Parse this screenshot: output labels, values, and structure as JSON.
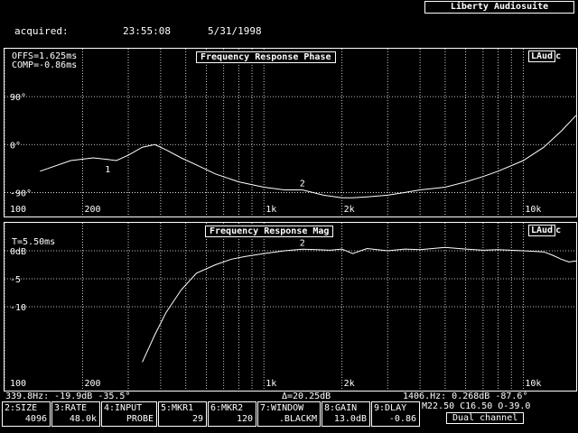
{
  "app": {
    "title": "Liberty Audiosuite"
  },
  "acquired": {
    "label": "acquired:",
    "time": "23:55:08",
    "date": "5/31/1998"
  },
  "phase_panel": {
    "title": "Frequency Response Phase",
    "logo_box": "LAud",
    "logo_suffix": "c",
    "offs": "OFFS=1.625ms",
    "comp": "COMP=-0.86ms",
    "marker1": "1",
    "marker2": "2"
  },
  "mag_panel": {
    "title": "Frequency Response Mag",
    "logo_box": "LAud",
    "logo_suffix": "c",
    "t": "T=5.50ms",
    "marker2": "2"
  },
  "status": {
    "left": "339.8Hz: -19.9dB  -35.5°",
    "mid": "Δ=20.25dB",
    "right": "1406.Hz: 0.268dB -87.6°"
  },
  "fkeys": [
    {
      "top": "2:SIZE",
      "bottom": "4096"
    },
    {
      "top": "3:RATE",
      "bottom": "48.0k"
    },
    {
      "top": "4:INPUT",
      "bottom": "PROBE"
    },
    {
      "top": "5:MKR1",
      "bottom": "29"
    },
    {
      "top": "6:MKR2",
      "bottom": "120"
    },
    {
      "top": "7:WINDOW",
      "bottom": ".BLACKM"
    },
    {
      "top": "8:GAIN",
      "bottom": "13.0dB"
    },
    {
      "top": "9:DLAY",
      "bottom": "-0.86"
    }
  ],
  "right_info": {
    "line1": "M22.50 C16.50 O-39.0",
    "dual": "Dual channel"
  },
  "chart_data": [
    {
      "type": "line",
      "title": "Frequency Response Phase",
      "xlabel": "",
      "ylabel": "",
      "x_scale": "log",
      "xlim": [
        100,
        16000
      ],
      "ylim": [
        -135,
        180
      ],
      "x_ticks": [
        {
          "v": 100,
          "label": "100"
        },
        {
          "v": 200,
          "label": "200"
        },
        {
          "v": 1000,
          "label": "1k"
        },
        {
          "v": 2000,
          "label": "2k"
        },
        {
          "v": 10000,
          "label": "10k"
        }
      ],
      "y_ticks": [
        {
          "v": 90,
          "label": "90°"
        },
        {
          "v": 0,
          "label": "0°"
        },
        {
          "v": -90,
          "label": "-90°"
        }
      ],
      "grid": true,
      "series": [
        {
          "x": [
            137,
            180,
            220,
            250,
            270,
            300,
            340,
            380,
            420,
            480,
            560,
            650,
            800,
            1000,
            1200,
            1406,
            1700,
            2000,
            2200,
            2500,
            3000,
            3500,
            4000,
            5000,
            6000,
            7000,
            8000,
            10000,
            12000,
            14000,
            16000
          ],
          "y": [
            -50,
            -30,
            -25,
            -28,
            -30,
            -20,
            -5,
            0,
            -10,
            -25,
            -40,
            -55,
            -70,
            -80,
            -85,
            -85,
            -95,
            -100,
            -100,
            -98,
            -95,
            -90,
            -85,
            -80,
            -70,
            -60,
            -50,
            -30,
            -5,
            25,
            55
          ]
        }
      ]
    },
    {
      "type": "line",
      "title": "Frequency Response Mag",
      "xlabel": "",
      "ylabel": "",
      "x_scale": "log",
      "xlim": [
        100,
        16000
      ],
      "ylim": [
        -25,
        5
      ],
      "x_ticks": [
        {
          "v": 100,
          "label": "100"
        },
        {
          "v": 200,
          "label": "200"
        },
        {
          "v": 1000,
          "label": "1k"
        },
        {
          "v": 2000,
          "label": "2k"
        },
        {
          "v": 10000,
          "label": "10k"
        }
      ],
      "y_ticks": [
        {
          "v": 0,
          "label": "0dB"
        },
        {
          "v": -5,
          "label": "-5"
        },
        {
          "v": -10,
          "label": "-10"
        }
      ],
      "grid": true,
      "series": [
        {
          "x": [
            339.8,
            380,
            420,
            480,
            550,
            650,
            750,
            850,
            1000,
            1200,
            1406,
            1600,
            1800,
            2000,
            2200,
            2500,
            3000,
            3500,
            4000,
            5000,
            6000,
            7000,
            8000,
            10000,
            12000,
            13000,
            14000,
            15000,
            16000
          ],
          "y": [
            -19.9,
            -15,
            -11,
            -7,
            -4,
            -2.5,
            -1.5,
            -1,
            -0.5,
            0,
            0.27,
            0.2,
            0.1,
            0.3,
            -0.5,
            0.4,
            0,
            0.3,
            0.2,
            0.6,
            0.3,
            0.1,
            0.2,
            0,
            -0.2,
            -0.8,
            -1.5,
            -2,
            -1.8
          ]
        }
      ]
    }
  ]
}
